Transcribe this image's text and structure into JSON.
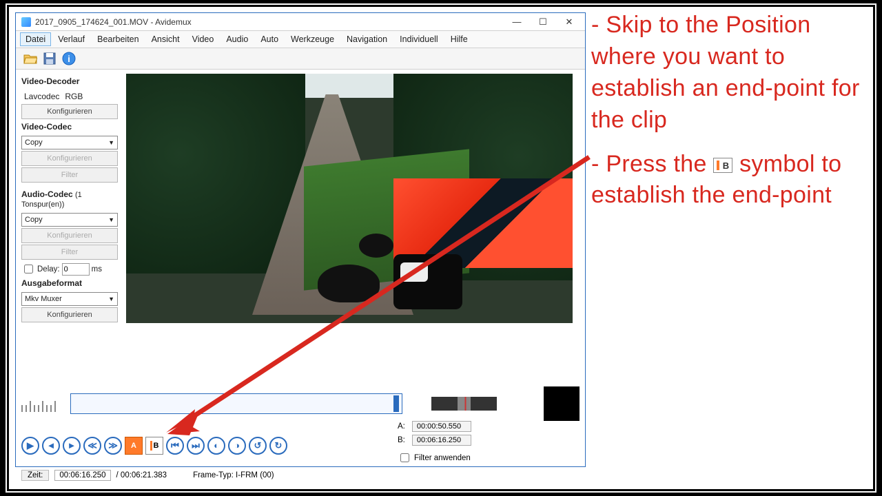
{
  "window": {
    "title": "2017_0905_174624_001.MOV - Avidemux"
  },
  "menu": [
    "Datei",
    "Verlauf",
    "Bearbeiten",
    "Ansicht",
    "Video",
    "Audio",
    "Auto",
    "Werkzeuge",
    "Navigation",
    "Individuell",
    "Hilfe"
  ],
  "sidebar": {
    "decoder_heading": "Video-Decoder",
    "decoder_codec": "Lavcodec",
    "decoder_color": "RGB",
    "configure": "Konfigurieren",
    "video_codec_heading": "Video-Codec",
    "video_codec_value": "Copy",
    "filter": "Filter",
    "audio_codec_heading": "Audio-Codec",
    "audio_tracks": "(1 Tonspur(en))",
    "audio_codec_value": "Copy",
    "delay_label": "Delay:",
    "delay_value": "0",
    "delay_unit": "ms",
    "output_heading": "Ausgabeformat",
    "output_value": "Mkv Muxer"
  },
  "timeline": {
    "a_label": "A:",
    "a_value": "00:00:50.550",
    "b_label": "B:",
    "b_value": "00:06:16.250",
    "filter_apply": "Filter anwenden",
    "zeit_label": "Zeit:",
    "time_current": "00:06:16.250",
    "time_total": "/ 00:06:21.383",
    "frame_type": "Frame-Typ:  I-FRM (00)"
  },
  "annotation": {
    "line1": "- Skip to the Position where you want to establish an end-point for the clip",
    "line2_a": "- Press the ",
    "line2_b": " symbol to establish the end-point"
  }
}
